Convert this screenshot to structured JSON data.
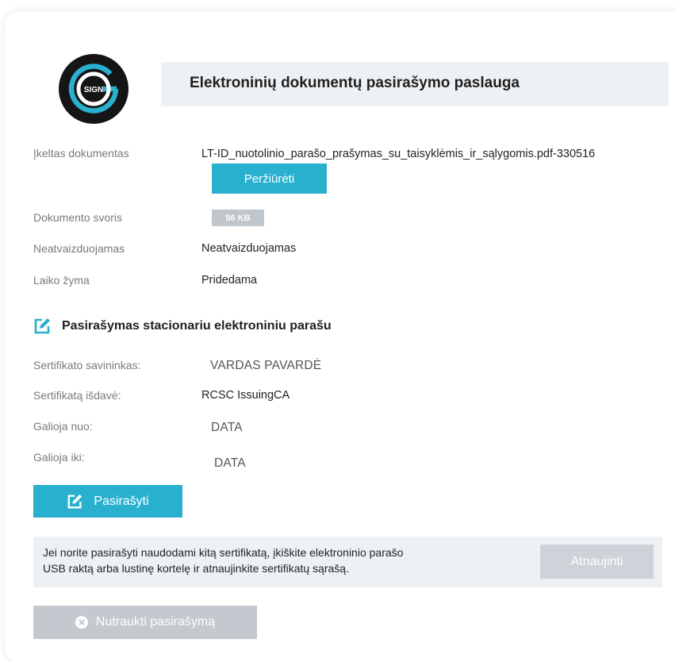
{
  "header": {
    "logo_text": "SIGN",
    "title": "Elektroninių dokumentų pasirašymo paslauga"
  },
  "document": {
    "uploaded_label": "Įkeltas dokumentas",
    "uploaded_value": "LT-ID_nuotolinio_parašo_prašymas_su_taisyklėmis_ir_sąlygomis.pdf-330516",
    "view_button": "Peržiūrėti",
    "weight_label": "Dokumento svoris",
    "weight_value": "56 KB",
    "display_label": "Neatvaizduojamas",
    "display_value": "Neatvaizduojamas",
    "timestamp_label": "Laiko žyma",
    "timestamp_value": "Pridedama"
  },
  "signing": {
    "section_title": "Pasirašymas stacionariu elektroniniu parašu",
    "owner_label": "Sertifikato savininkas:",
    "owner_value": "VARDAS PAVARDĖ",
    "issuer_label": "Sertifikatą išdavė:",
    "issuer_value": "RCSC IssuingCA",
    "valid_from_label": "Galioja nuo:",
    "valid_from_value": "DATA",
    "valid_to_label": "Galioja iki:",
    "valid_to_value": "DATA",
    "sign_button": "Pasirašyti"
  },
  "info": {
    "line1": "Jei norite pasirašyti naudodami kitą sertifikatą, įkiškite elektroninio parašo",
    "line2": "USB raktą arba lustinę kortelę ir atnaujinkite sertifikatų sąrašą.",
    "refresh_button": "Atnaujinti"
  },
  "footer": {
    "cancel_button": "Nutraukti pasirašymą"
  },
  "colors": {
    "accent": "#2ab0cf",
    "panel_bg": "#eef1f4",
    "disabled_button": "#cdd3d8"
  },
  "icons": {
    "section": "edit-icon",
    "sign_button": "edit-icon",
    "cancel_button": "close-circle-icon"
  }
}
